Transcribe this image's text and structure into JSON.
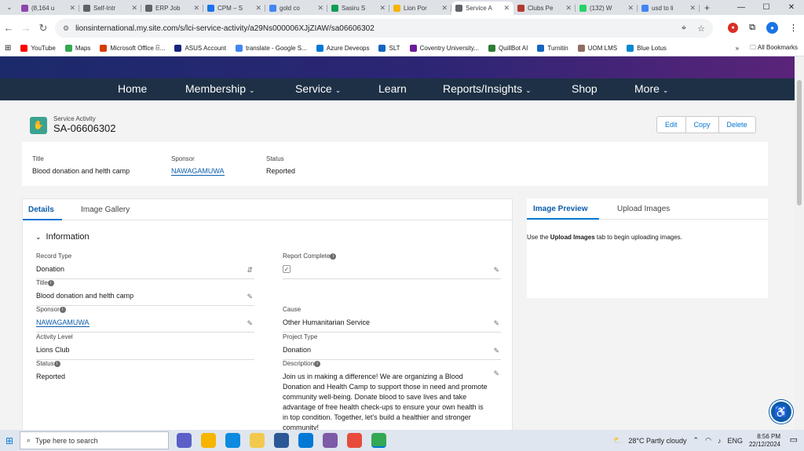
{
  "browser": {
    "tabs": [
      {
        "label": "(8,164 u",
        "color": "#8e44ad"
      },
      {
        "label": "Self-Intr",
        "color": "#5f6368"
      },
      {
        "label": "ERP Job",
        "color": "#5f6368"
      },
      {
        "label": "CPM – S",
        "color": "#1a73e8"
      },
      {
        "label": "gold co",
        "color": "#4285f4"
      },
      {
        "label": "Sasiru S",
        "color": "#0f9d58"
      },
      {
        "label": "Lion Por",
        "color": "#f4b400"
      },
      {
        "label": "Service A",
        "color": "#5f6368"
      },
      {
        "label": "Clubs Pe",
        "color": "#b03a2e"
      },
      {
        "label": "(132) W",
        "color": "#25d366"
      },
      {
        "label": "usd to li",
        "color": "#4285f4"
      }
    ],
    "url": "lionsinternational.my.site.com/s/lci-service-activity/a29Ns000006XJjZIAW/sa06606302",
    "bookmarks": [
      {
        "label": "YouTube",
        "color": "#ff0000"
      },
      {
        "label": "Maps",
        "color": "#34a853"
      },
      {
        "label": "Microsoft Office සි...",
        "color": "#d83b01"
      },
      {
        "label": "ASUS Account",
        "color": "#1a237e"
      },
      {
        "label": "translate - Google S...",
        "color": "#4285f4"
      },
      {
        "label": "Azure Deveops",
        "color": "#0078d4"
      },
      {
        "label": "SLT",
        "color": "#1565c0"
      },
      {
        "label": "Coventry University...",
        "color": "#6a1b9a"
      },
      {
        "label": "QuillBot AI",
        "color": "#2e7d32"
      },
      {
        "label": "Turnitin",
        "color": "#1565c0"
      },
      {
        "label": "UOM LMS",
        "color": "#8d6e63"
      },
      {
        "label": "Blue Lotus",
        "color": "#0288d1"
      }
    ],
    "all_bookmarks": "All Bookmarks",
    "more_bm": "»"
  },
  "nav": {
    "items": [
      "Home",
      "Membership",
      "Service",
      "Learn",
      "Reports/Insights",
      "Shop",
      "More"
    ]
  },
  "record": {
    "type_label": "Service Activity",
    "name": "SA-06606302",
    "actions": [
      "Edit",
      "Copy",
      "Delete"
    ],
    "highlights": [
      {
        "label": "Title",
        "value": "Blood donation and helth camp"
      },
      {
        "label": "Sponsor",
        "value": "NAWAGAMUWA"
      },
      {
        "label": "Status",
        "value": "Reported"
      }
    ]
  },
  "details": {
    "tabs": [
      "Details",
      "Image Gallery"
    ],
    "section": "Information",
    "fields": {
      "record_type_label": "Record Type",
      "record_type": "Donation",
      "report_complete_label": "Report Complete",
      "title_label": "Title",
      "title": "Blood donation and helth camp",
      "sponsor_label": "Sponsor",
      "sponsor": "NAWAGAMUWA",
      "cause_label": "Cause",
      "cause": "Other Humanitarian Service",
      "activity_level_label": "Activity Level",
      "activity_level": "Lions Club",
      "project_type_label": "Project Type",
      "project_type": "Donation",
      "status_label": "Status",
      "status": "Reported",
      "description_label": "Description",
      "description": "Join us in making a difference! We are organizing a Blood Donation and Health Camp to support those in need and promote community well-being. Donate blood to save lives and take advantage of free health check-ups to ensure your own health is in top condition. Together, let's build a healthier and stronger community!"
    }
  },
  "preview": {
    "tabs": [
      "Image Preview",
      "Upload Images"
    ],
    "text_before": "Use the ",
    "text_bold": "Upload Images",
    "text_after": " tab to begin uploading images."
  },
  "taskbar": {
    "search_placeholder": "Type here to search",
    "weather": "28°C  Partly cloudy",
    "lang": "ENG",
    "time": "8:56 PM",
    "date": "22/12/2024"
  }
}
